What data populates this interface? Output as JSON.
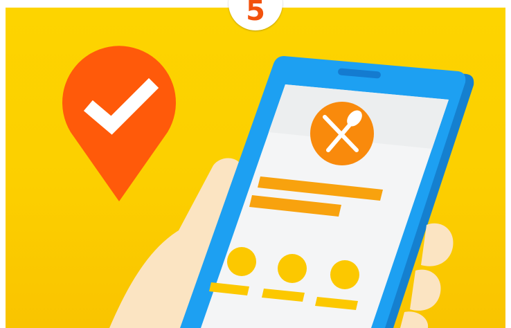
{
  "step_badge": {
    "number": "5"
  },
  "icons": {
    "location_pin": "map-pin-check-icon",
    "restaurant": "fork-spoon-icon"
  },
  "colors": {
    "background_yellow": "#fdd400",
    "accent_orange": "#ff5a0a",
    "bar_orange": "#f8a20e",
    "phone_blue": "#1da0f2",
    "screen": "#f4f5f6",
    "dot_yellow": "#fcc800",
    "hand": "#fbe4c2"
  }
}
